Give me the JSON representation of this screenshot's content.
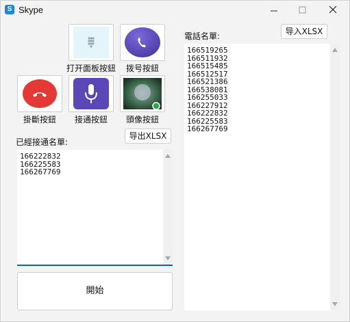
{
  "window": {
    "title": "Skype",
    "icon": "skype-icon"
  },
  "buttons": {
    "keypad": "打开面板按鈕",
    "dial": "拨号按鈕",
    "hangup": "掛斷按鈕",
    "answer": "接通按鈕",
    "avatar": "頭像按鈕",
    "export": "导出XLSX",
    "import": "导入XLSX",
    "start": "開始"
  },
  "connected_list": {
    "label": "已經接通名單:",
    "lines": [
      "166222832",
      "166225583",
      "166267769"
    ]
  },
  "phone_list": {
    "label": "電話名單:",
    "lines": [
      "166519265",
      "166511932",
      "166515485",
      "166512517",
      "166521386",
      "166538081",
      "166255033",
      "166227912",
      "166222832",
      "166225583",
      "166267769"
    ]
  },
  "colors": {
    "accent": "#0067c0",
    "hangup_red": "#e53935",
    "purple": "#5b47b8"
  }
}
